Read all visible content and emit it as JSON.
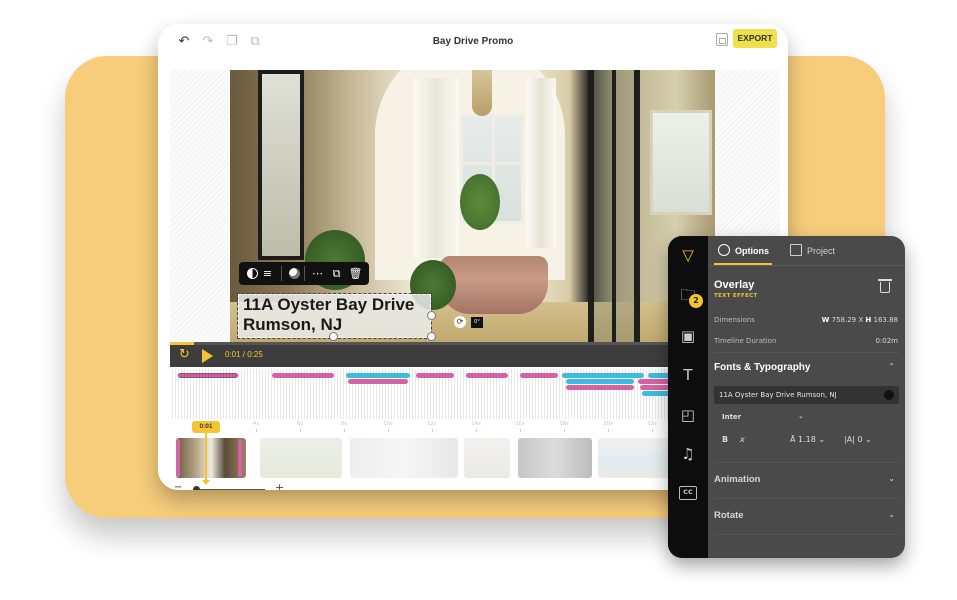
{
  "app": {
    "title": "Bay Drive Promo",
    "export_label": "EXPORT",
    "toolbar_icons": [
      "undo-icon",
      "redo-icon",
      "layer-forward-icon",
      "group-icon"
    ]
  },
  "canvas": {
    "overlay_text_line1": "11A Oyster Bay Drive",
    "overlay_text_line2": "Rumson, NJ",
    "rotation_angle": "0°",
    "overlay_toolbar_icons": [
      "contrast-icon",
      "align-icon",
      "blend-icon",
      "more-icon",
      "duplicate-icon",
      "delete-icon"
    ]
  },
  "playback": {
    "timecode": "0:01 / 0:25",
    "progress_fraction": 0.04
  },
  "timeline": {
    "playhead_label": "0:01",
    "ticks": [
      "4s",
      "6s",
      "8s",
      "10s",
      "12s",
      "14s",
      "16s",
      "18s",
      "20s",
      "22s"
    ],
    "zoom_minus": "−",
    "zoom_plus": "+",
    "zoom_level_fraction": 0.0
  },
  "panel": {
    "tabs": [
      {
        "label": "Options",
        "active": true
      },
      {
        "label": "Project",
        "active": false
      }
    ],
    "rail_badge": "2",
    "rail_cc_label": "CC",
    "section_title": "Overlay",
    "section_subtitle": "TEXT EFFECT",
    "dimensions_label": "Dimensions",
    "dimensions_w_label": "W",
    "dimensions_w": "758.29",
    "dimensions_x": "X",
    "dimensions_h_label": "H",
    "dimensions_h": "163.88",
    "duration_label": "Timeline Duration",
    "duration_value": "0:02m",
    "fonts_title": "Fonts & Typography",
    "text_value": "11A Oyster Bay Drive Rumson, NJ",
    "font_family": "Inter",
    "bold_label": "B",
    "line_height": "1.18",
    "letter_spacing": "0",
    "animation_title": "Animation",
    "rotate_title": "Rotate"
  },
  "colors": {
    "accent": "#f5c531",
    "export": "#ede04a",
    "backdrop": "#f7cd7c",
    "clip_pink": "#d264a6",
    "clip_blue": "#3ebce0",
    "panel_bg": "#4a4a4a"
  }
}
